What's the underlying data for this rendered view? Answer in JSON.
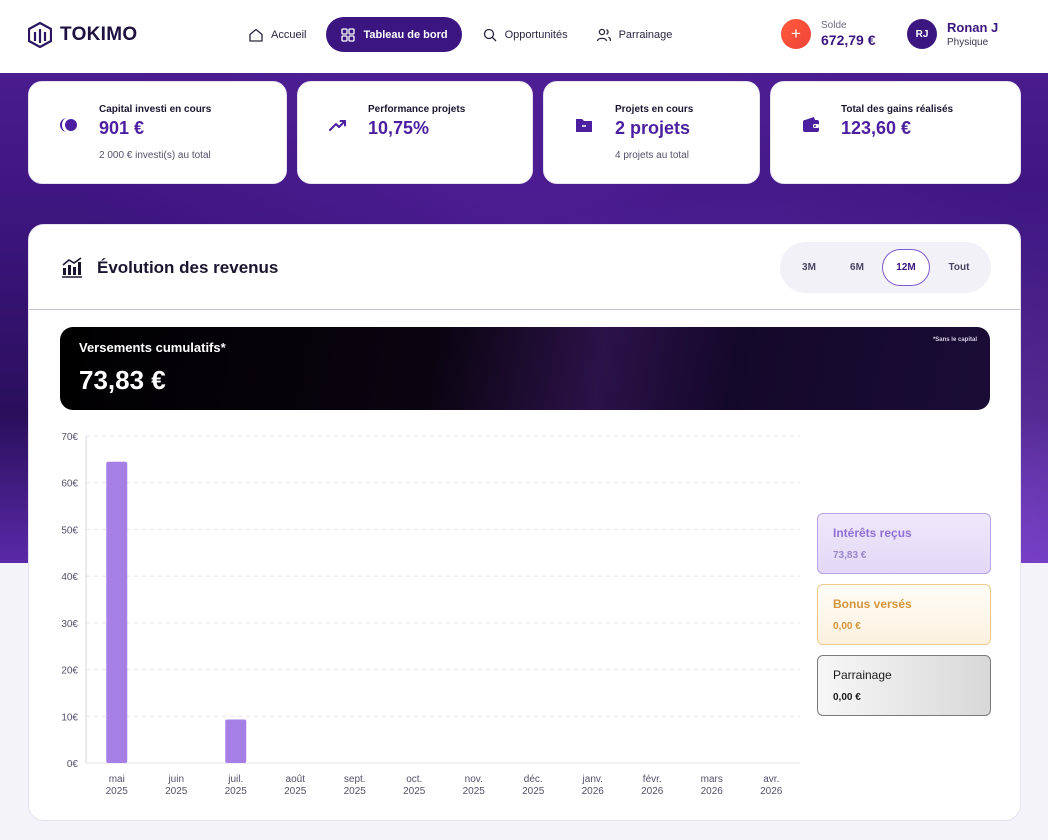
{
  "brand": {
    "name": "TOKIMO",
    "accent": "#3b1680",
    "bar_color": "#a57ee6"
  },
  "nav": {
    "items": [
      {
        "label": "Accueil",
        "icon": "home-icon"
      },
      {
        "label": "Tableau de bord",
        "icon": "grid-icon",
        "active": true
      },
      {
        "label": "Opportunités",
        "icon": "search-icon"
      },
      {
        "label": "Parrainage",
        "icon": "users-icon"
      }
    ]
  },
  "balance": {
    "label": "Solde",
    "value": "672,79 €",
    "icon": "plus-icon"
  },
  "user": {
    "initials": "RJ",
    "name": "Ronan J",
    "type": "Physique"
  },
  "stats": [
    {
      "label": "Capital investi en cours",
      "value": "901 €",
      "sub": "2 000 € investi(s) au total",
      "icon": "pie-icon"
    },
    {
      "label": "Performance projets",
      "value": "10,75%",
      "sub": "",
      "icon": "trend-up-icon"
    },
    {
      "label": "Projets en cours",
      "value": "2 projets",
      "sub": "4 projets au total",
      "icon": "folder-icon"
    },
    {
      "label": "Total des gains réalisés",
      "value": "123,60 €",
      "sub": "",
      "icon": "wallet-icon"
    }
  ],
  "panel": {
    "title": "Évolution des revenus",
    "title_icon": "bar-chart-icon",
    "ranges": [
      "3M",
      "6M",
      "12M",
      "Tout"
    ],
    "active_range": "12M"
  },
  "cumulative": {
    "title": "Versements cumulatifs*",
    "value": "73,83 €",
    "note": "*Sans le capital"
  },
  "chart_data": {
    "type": "bar",
    "categories": [
      [
        "mai",
        "2025"
      ],
      [
        "juin",
        "2025"
      ],
      [
        "juil.",
        "2025"
      ],
      [
        "août",
        "2025"
      ],
      [
        "sept.",
        "2025"
      ],
      [
        "oct.",
        "2025"
      ],
      [
        "nov.",
        "2025"
      ],
      [
        "déc.",
        "2025"
      ],
      [
        "janv.",
        "2026"
      ],
      [
        "févr.",
        "2026"
      ],
      [
        "mars",
        "2026"
      ],
      [
        "avr.",
        "2026"
      ]
    ],
    "series": [
      {
        "name": "Intérêts reçus",
        "values": [
          64.5,
          0,
          9.3,
          0,
          0,
          0,
          0,
          0,
          0,
          0,
          0,
          0
        ]
      }
    ],
    "yticks": [
      "0€",
      "10€",
      "20€",
      "30€",
      "40€",
      "50€",
      "60€",
      "70€"
    ],
    "ylim": [
      0,
      70
    ],
    "grid": true
  },
  "legend": [
    {
      "name": "Intérêts reçus",
      "value": "73,83 €"
    },
    {
      "name": "Bonus versés",
      "value": "0,00 €"
    },
    {
      "name": "Parrainage",
      "value": "0,00 €"
    }
  ]
}
